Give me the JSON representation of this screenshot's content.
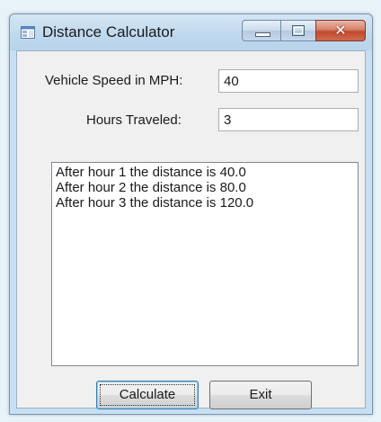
{
  "window": {
    "title": "Distance Calculator"
  },
  "form": {
    "speed_label": "Vehicle Speed in MPH:",
    "speed_value": "40",
    "hours_label": "Hours Traveled:",
    "hours_value": "3"
  },
  "results": {
    "items": [
      "After hour 1 the distance is 40.0",
      "After hour 2 the distance is 80.0",
      "After hour 3 the distance is 120.0"
    ]
  },
  "buttons": {
    "calculate_label": "Calculate",
    "exit_label": "Exit"
  },
  "icons": {
    "app": "form-window-icon",
    "minimize": "minimize-icon",
    "maximize": "maximize-icon",
    "close": "close-icon"
  },
  "colors": {
    "title_bar": "#c7dff1",
    "close_button": "#c24a2e",
    "form_background": "#f0f0f0"
  }
}
